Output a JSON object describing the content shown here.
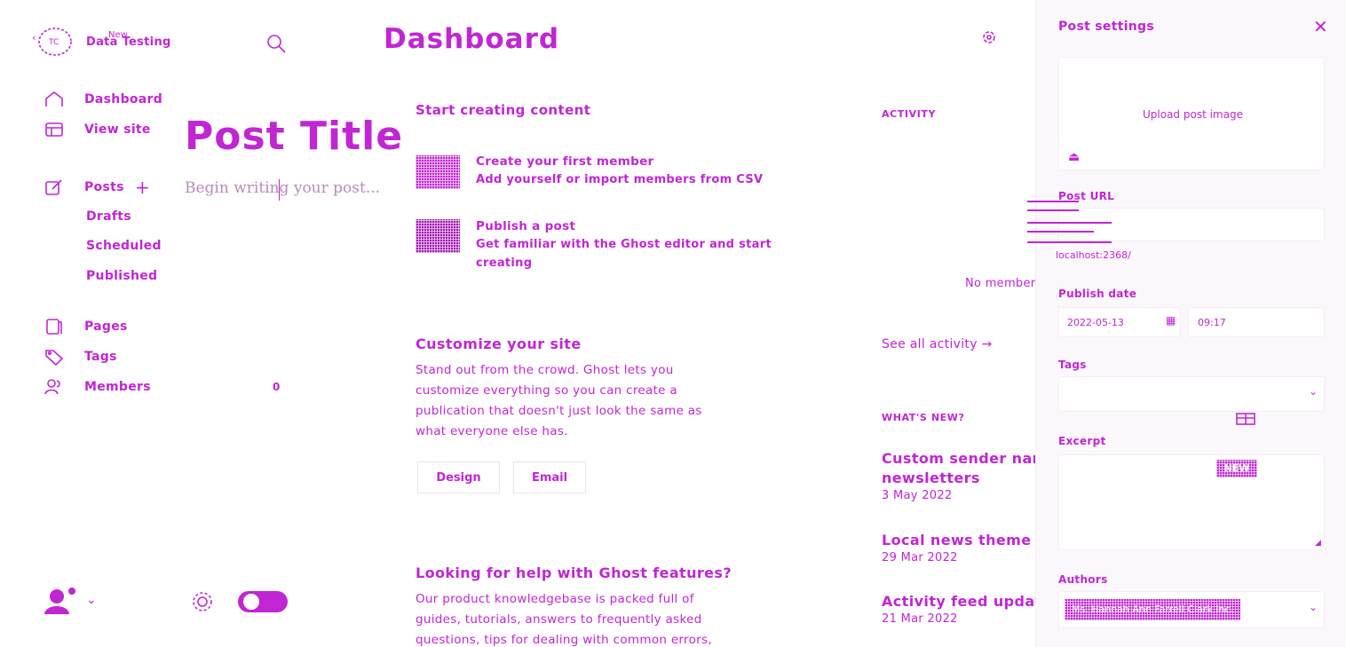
{
  "colors": {
    "accent": "#c026d3",
    "panel_bg": "#fbf8fc",
    "border": "#f0e6f2"
  },
  "sidebar": {
    "site_title": "Data Testing",
    "new_label": "New",
    "items": [
      {
        "label": "Dashboard",
        "icon": "home-icon"
      },
      {
        "label": "View site",
        "icon": "browser-icon"
      },
      {
        "label": "Posts",
        "icon": "edit-icon"
      },
      {
        "label": "Drafts"
      },
      {
        "label": "Scheduled"
      },
      {
        "label": "Published"
      },
      {
        "label": "Pages",
        "icon": "pages-icon"
      },
      {
        "label": "Tags",
        "icon": "tag-icon"
      },
      {
        "label": "Members",
        "icon": "members-icon",
        "count": "0"
      }
    ]
  },
  "editor": {
    "title": "Post Title",
    "placeholder": "Begin writing your post..."
  },
  "dashboard": {
    "heading": "Dashboard",
    "start_section": "Start creating content",
    "cards": [
      {
        "title": "Create your first member",
        "desc": "Add yourself or import members from CSV"
      },
      {
        "title": "Publish a post",
        "desc_line1": "Get familiar with the Ghost editor and start",
        "desc_line2": "creating"
      }
    ],
    "customize": {
      "title": "Customize your site",
      "lines": [
        "Stand out from the crowd. Ghost lets you",
        "customize everything so you can create a",
        "publication that doesn't just look the same as",
        "what everyone else has."
      ],
      "btn_design": "Design",
      "btn_email": "Email"
    },
    "help": {
      "title": "Looking for help with Ghost features?",
      "lines": [
        "Our product knowledgebase is packed full of",
        "guides, tutorials, answers to frequently asked",
        "questions, tips for dealing with common errors,"
      ]
    },
    "activity_label": "ACTIVITY",
    "no_activity": "No member activity available.",
    "see_all": "See all activity →",
    "whats_new_label": "WHAT'S NEW?",
    "news": [
      {
        "title_line1": "Custom sender names for",
        "title_line2": "newsletters",
        "date": "3 May 2022"
      },
      {
        "title_line1": "Local news theme",
        "date": "29 Mar 2022"
      },
      {
        "title_line1": "Activity feed updates",
        "date": "21 Mar 2022"
      }
    ],
    "new_badge": "NEW"
  },
  "post_settings": {
    "title": "Post settings",
    "upload_label": "Upload post image",
    "url_label": "Post URL",
    "url_preview": "localhost:2368/",
    "publish_label": "Publish date",
    "date_value": "2022-05-13",
    "time_value": "09:17",
    "tags_label": "Tags",
    "excerpt_label": "Excerpt",
    "authors_label": "Authors",
    "author_value": "Ms. Hannah Ann Farrell Clark Inc."
  }
}
